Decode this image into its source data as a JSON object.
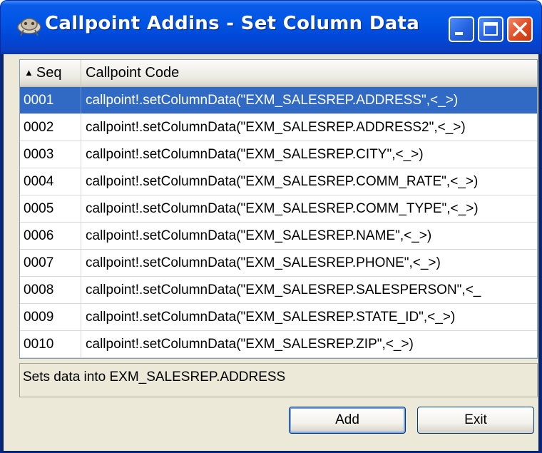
{
  "window": {
    "title": "Callpoint Addins - Set Column Data",
    "icon": "callpoint-app-icon",
    "controls": [
      "minimize-icon",
      "maximize-icon",
      "close-icon"
    ]
  },
  "grid": {
    "columns": [
      "Seq",
      "Callpoint Code"
    ],
    "sort_indicator": "ascending",
    "selected_index": 0,
    "rows": [
      {
        "seq": "0001",
        "code": "callpoint!.setColumnData(\"EXM_SALESREP.ADDRESS\",<_>)"
      },
      {
        "seq": "0002",
        "code": "callpoint!.setColumnData(\"EXM_SALESREP.ADDRESS2\",<_>)"
      },
      {
        "seq": "0003",
        "code": "callpoint!.setColumnData(\"EXM_SALESREP.CITY\",<_>)"
      },
      {
        "seq": "0004",
        "code": "callpoint!.setColumnData(\"EXM_SALESREP.COMM_RATE\",<_>)"
      },
      {
        "seq": "0005",
        "code": "callpoint!.setColumnData(\"EXM_SALESREP.COMM_TYPE\",<_>)"
      },
      {
        "seq": "0006",
        "code": "callpoint!.setColumnData(\"EXM_SALESREP.NAME\",<_>)"
      },
      {
        "seq": "0007",
        "code": "callpoint!.setColumnData(\"EXM_SALESREP.PHONE\",<_>)"
      },
      {
        "seq": "0008",
        "code": "callpoint!.setColumnData(\"EXM_SALESREP.SALESPERSON\",<_"
      },
      {
        "seq": "0009",
        "code": "callpoint!.setColumnData(\"EXM_SALESREP.STATE_ID\",<_>)"
      },
      {
        "seq": "0010",
        "code": "callpoint!.setColumnData(\"EXM_SALESREP.ZIP\",<_>)"
      }
    ]
  },
  "status": {
    "text": "Sets data into EXM_SALESREP.ADDRESS"
  },
  "buttons": {
    "add": "Add",
    "exit": "Exit"
  },
  "colors": {
    "selection": "#316ac5",
    "titlebar": "#0055e5",
    "dialog": "#ece9d8"
  }
}
